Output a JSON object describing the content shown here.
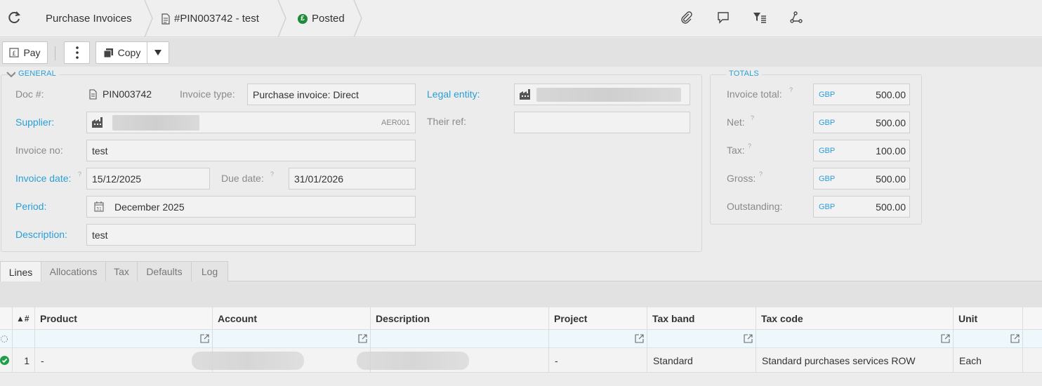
{
  "breadcrumb": {
    "module": "Purchase Invoices",
    "document": "#PIN003742 - test",
    "status": "Posted",
    "status_glyph": "£"
  },
  "toolbar": {
    "pay_label": "Pay",
    "copy_label": "Copy"
  },
  "general": {
    "legend": "GENERAL",
    "doc_label": "Doc #:",
    "doc_value": "PIN003742",
    "invoice_type_label": "Invoice type:",
    "invoice_type_value": "Purchase invoice: Direct",
    "legal_entity_label": "Legal entity:",
    "supplier_label": "Supplier:",
    "supplier_code": "AER001",
    "their_ref_label": "Their ref:",
    "their_ref_value": "",
    "invoice_no_label": "Invoice no:",
    "invoice_no_value": "test",
    "invoice_date_label": "Invoice date:",
    "invoice_date_value": "15/12/2025",
    "due_date_label": "Due date:",
    "due_date_value": "31/01/2026",
    "period_label": "Period:",
    "period_value": "December 2025",
    "period_icon_day": "31",
    "description_label": "Description:",
    "description_value": "test",
    "hint": "?"
  },
  "totals": {
    "legend": "TOTALS",
    "currency": "GBP",
    "rows": [
      {
        "label": "Invoice total:",
        "value": "500.00"
      },
      {
        "label": "Net:",
        "value": "500.00"
      },
      {
        "label": "Tax:",
        "value": "100.00"
      },
      {
        "label": "Gross:",
        "value": "500.00"
      },
      {
        "label": "Outstanding:",
        "value": "500.00"
      }
    ]
  },
  "tabs": [
    "Lines",
    "Allocations",
    "Tax",
    "Defaults",
    "Log"
  ],
  "grid": {
    "sort_col": "▲#",
    "columns": [
      "Product",
      "Account",
      "Description",
      "Project",
      "Tax band",
      "Tax code",
      "Unit"
    ],
    "rows": [
      {
        "num": "1",
        "product": "-",
        "project": "-",
        "tax_band": "Standard",
        "tax_code": "Standard purchases services ROW",
        "unit": "Each"
      }
    ]
  },
  "colors": {
    "accent": "#2a9fd6",
    "posted": "#1e8a3c"
  }
}
